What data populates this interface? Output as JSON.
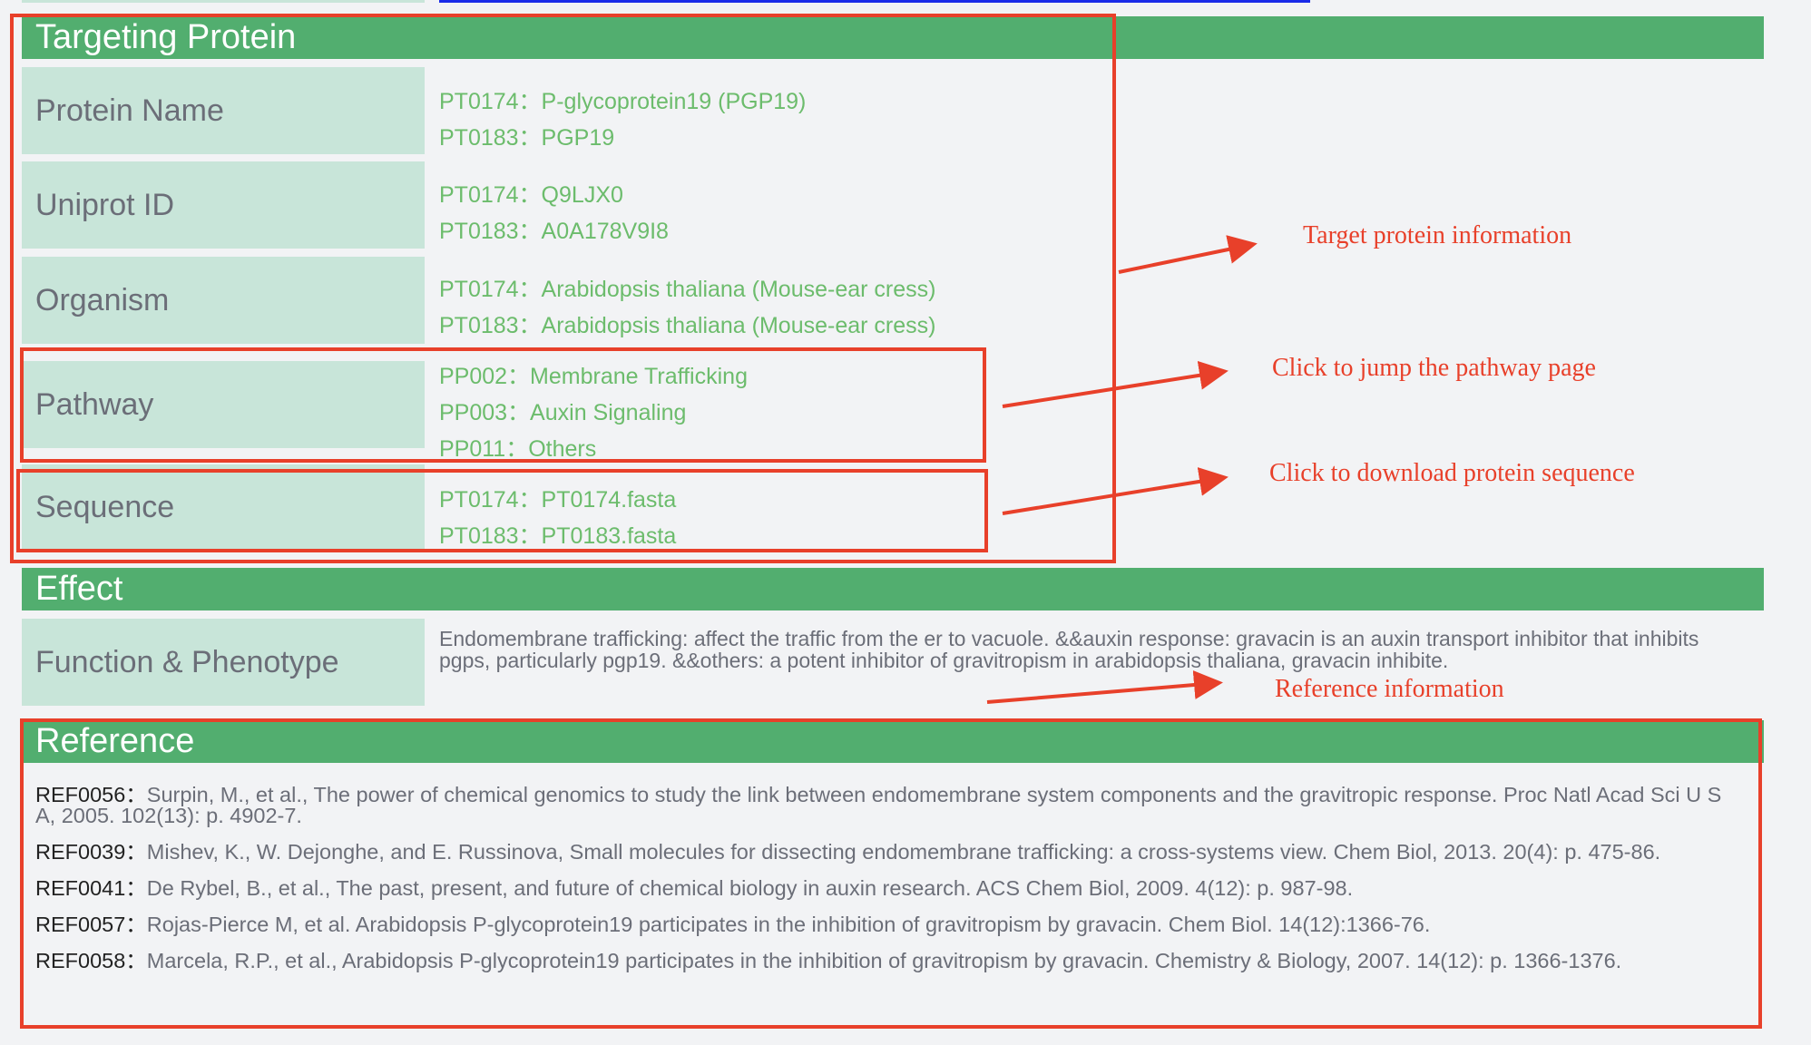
{
  "targeting_protein": {
    "title": "Targeting Protein",
    "rows": [
      {
        "label": "Protein Name",
        "values": [
          "PT0174：P-glycoprotein19 (PGP19)",
          "PT0183：PGP19"
        ]
      },
      {
        "label": "Uniprot ID",
        "values": [
          "PT0174：Q9LJX0",
          "PT0183：A0A178V9I8"
        ]
      },
      {
        "label": "Organism",
        "values": [
          "PT0174：Arabidopsis thaliana (Mouse-ear cress)",
          "PT0183：Arabidopsis thaliana (Mouse-ear cress)"
        ]
      },
      {
        "label": "Pathway",
        "values": [
          "PP002：Membrane Trafficking",
          "PP003：Auxin Signaling",
          "PP011：Others"
        ]
      },
      {
        "label": "Sequence",
        "values": [
          "PT0174：PT0174.fasta",
          "PT0183：PT0183.fasta"
        ]
      }
    ]
  },
  "effect": {
    "title": "Effect",
    "label": "Function & Phenotype",
    "text": "Endomembrane trafficking: affect the traffic from the er to vacuole. &&auxin response: gravacin is an auxin transport inhibitor that inhibits pgps, particularly pgp19. &&others: a potent inhibitor of gravitropism in arabidopsis thaliana, gravacin inhibite."
  },
  "reference": {
    "title": "Reference",
    "items": [
      {
        "id": "REF0056：",
        "text": "Surpin, M., et al., The power of chemical genomics to study the link between endomembrane system components and the gravitropic response. Proc Natl Acad Sci U S A, 2005. 102(13): p. 4902-7."
      },
      {
        "id": "REF0039：",
        "text": "Mishev, K., W. Dejonghe, and E. Russinova, Small molecules for dissecting endomembrane trafficking: a cross-systems view. Chem Biol, 2013. 20(4): p. 475-86."
      },
      {
        "id": "REF0041：",
        "text": "De Rybel, B., et al., The past, present, and future of chemical biology in auxin research. ACS Chem Biol, 2009. 4(12): p. 987-98."
      },
      {
        "id": "REF0057：",
        "text": "Rojas-Pierce M, et al. Arabidopsis P-glycoprotein19 participates in the inhibition of gravitropism by gravacin. Chem Biol. 14(12):1366-76."
      },
      {
        "id": "REF0058：",
        "text": "Marcela, R.P., et al., Arabidopsis P-glycoprotein19 participates in the inhibition of gravitropism by gravacin. Chemistry & Biology, 2007. 14(12): p. 1366-1376."
      }
    ]
  },
  "annotations": {
    "target_protein": "Target protein information",
    "pathway": "Click to jump the pathway page",
    "sequence": "Click to download protein sequence",
    "reference": "Reference information"
  },
  "colors": {
    "header": "#52ae6f",
    "label_bg": "#c8e5d9",
    "link": "#6cbc6c",
    "annotation": "#e8402a"
  }
}
